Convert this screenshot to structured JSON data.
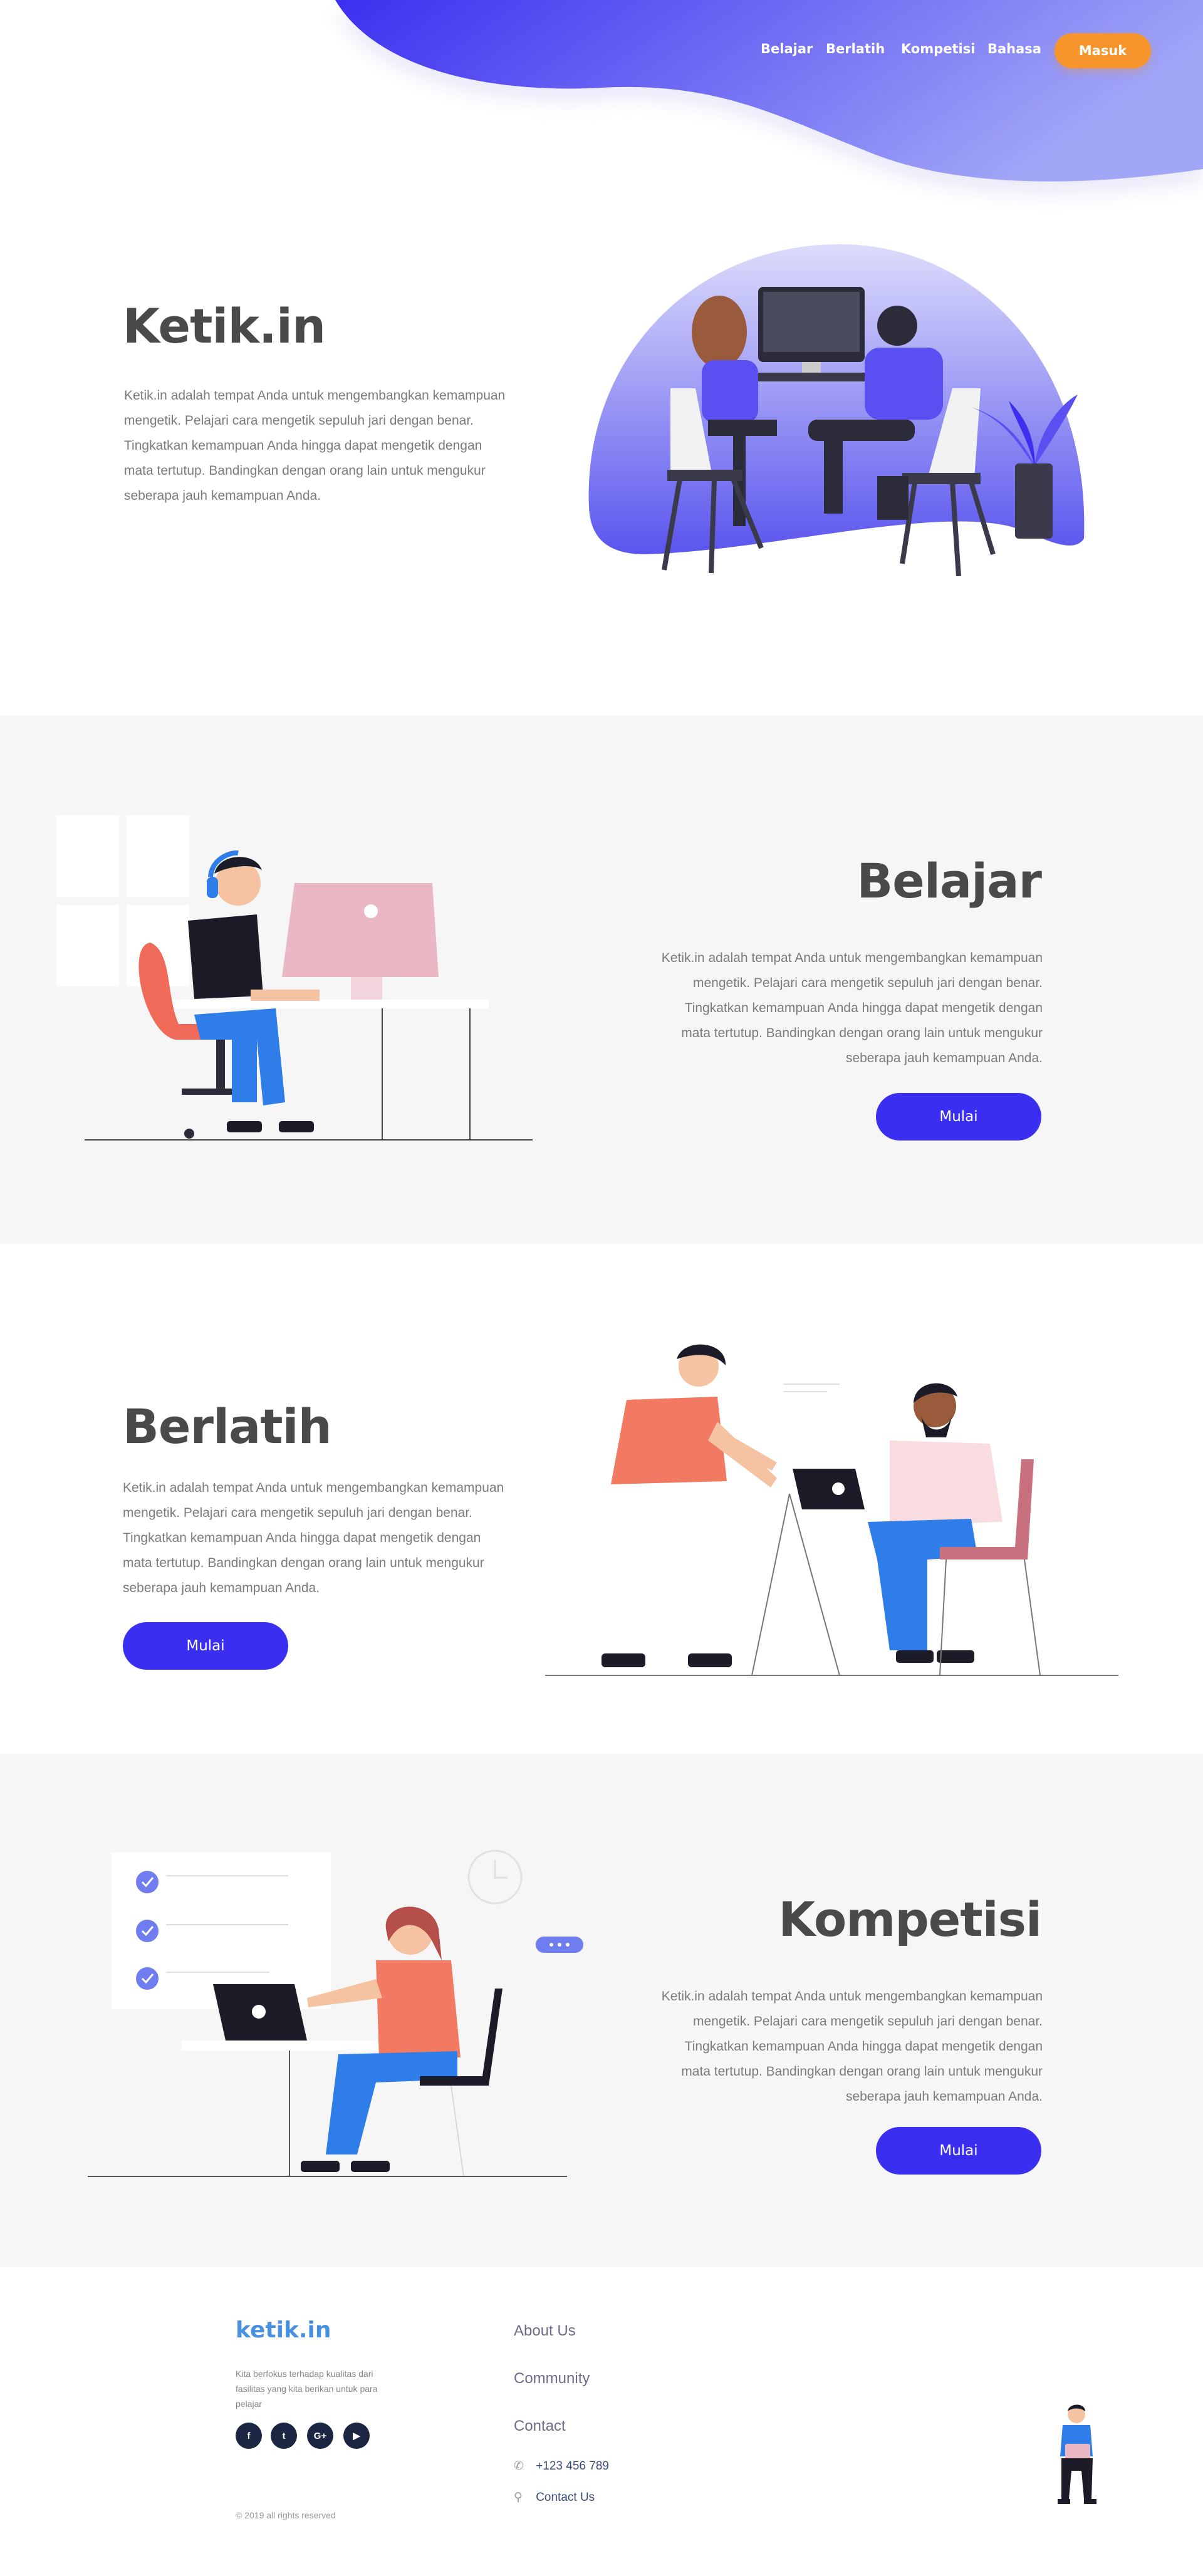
{
  "nav": {
    "items": [
      {
        "label": "Belajar"
      },
      {
        "label": "Berlatih"
      },
      {
        "label": "Kompetisi"
      },
      {
        "label": "Bahasa"
      }
    ],
    "login_label": "Masuk"
  },
  "hero": {
    "title": "Ketik.in",
    "description": "Ketik.in adalah tempat Anda untuk mengembangkan kemampuan mengetik. Pelajari cara mengetik sepuluh jari dengan benar. Tingkatkan kemampuan Anda hingga dapat mengetik dengan mata tertutup. Bandingkan dengan orang lain untuk mengukur seberapa jauh kemampuan Anda."
  },
  "sections": [
    {
      "title": "Belajar",
      "description": "Ketik.in adalah tempat Anda untuk mengembangkan kemampuan mengetik. Pelajari cara mengetik sepuluh jari dengan benar. Tingkatkan kemampuan Anda hingga dapat mengetik dengan mata tertutup. Bandingkan dengan orang lain untuk mengukur seberapa jauh kemampuan Anda.",
      "button": "Mulai"
    },
    {
      "title": "Berlatih",
      "description": "Ketik.in adalah tempat Anda untuk mengembangkan kemampuan mengetik. Pelajari cara mengetik sepuluh jari dengan benar. Tingkatkan kemampuan Anda hingga dapat mengetik dengan mata tertutup. Bandingkan dengan orang lain untuk mengukur seberapa jauh kemampuan Anda.",
      "button": "Mulai"
    },
    {
      "title": "Kompetisi",
      "description": "Ketik.in adalah tempat Anda untuk mengembangkan kemampuan mengetik. Pelajari cara mengetik sepuluh jari dengan benar. Tingkatkan kemampuan Anda hingga dapat mengetik dengan mata tertutup. Bandingkan dengan orang lain untuk mengukur seberapa jauh kemampuan Anda.",
      "button": "Mulai"
    }
  ],
  "footer": {
    "logo": "ketik.in",
    "tagline": "Kita berfokus terhadap kualitas dari fasilitas yang kita berikan untuk para pelajar",
    "social": [
      {
        "icon": "facebook-icon",
        "glyph": "f"
      },
      {
        "icon": "twitter-icon",
        "glyph": "t"
      },
      {
        "icon": "google-plus-icon",
        "glyph": "G+"
      },
      {
        "icon": "youtube-icon",
        "glyph": "▶"
      }
    ],
    "links": [
      {
        "label": "About Us"
      },
      {
        "label": "Community"
      },
      {
        "label": "Contact"
      }
    ],
    "phone": "+123 456 789",
    "contact_label": "Contact Us",
    "copyright": "© 2019 all rights reserved"
  },
  "colors": {
    "accent": "#3a2ff0",
    "wave_start": "#3d2ff0",
    "wave_end": "#9aa0f7",
    "login": "#f7952c",
    "band": "#f6f6f6",
    "logo": "#4a90e2"
  }
}
